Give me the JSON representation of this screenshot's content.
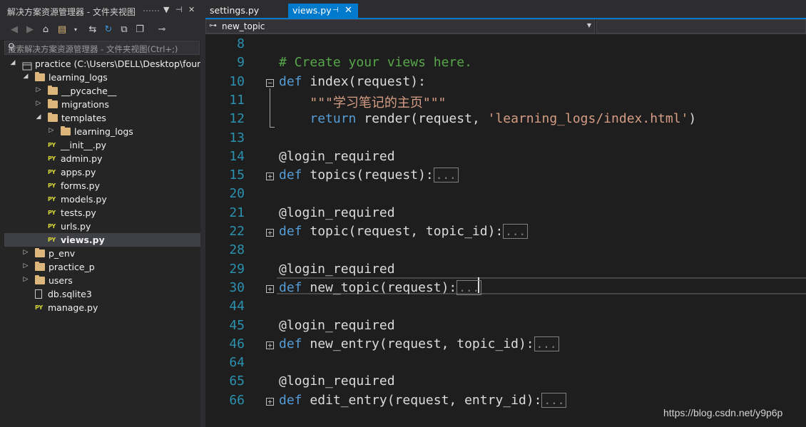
{
  "solution_explorer": {
    "title": "解决方案资源管理器 - 文件夹视图",
    "search_placeholder": "搜索解决方案资源管理器 - 文件夹视图(Ctrl+;)",
    "tree": [
      {
        "label": "practice (C:\\Users\\DELL\\Desktop\\four\\l",
        "icon": "solution-icon",
        "expanded": true
      },
      {
        "label": "learning_logs",
        "icon": "folder-icon",
        "expanded": true
      },
      {
        "label": "__pycache__",
        "icon": "folder-icon",
        "expanded": false
      },
      {
        "label": "migrations",
        "icon": "folder-icon",
        "expanded": false
      },
      {
        "label": "templates",
        "icon": "folder-icon",
        "expanded": true
      },
      {
        "label": "learning_logs",
        "icon": "folder-icon",
        "expanded": false
      },
      {
        "label": "__init__.py",
        "icon": "python-file-icon"
      },
      {
        "label": "admin.py",
        "icon": "python-file-icon"
      },
      {
        "label": "apps.py",
        "icon": "python-file-icon"
      },
      {
        "label": "forms.py",
        "icon": "python-file-icon"
      },
      {
        "label": "models.py",
        "icon": "python-file-icon"
      },
      {
        "label": "tests.py",
        "icon": "python-file-icon"
      },
      {
        "label": "urls.py",
        "icon": "python-file-icon"
      },
      {
        "label": "views.py",
        "icon": "python-file-icon",
        "selected": true
      },
      {
        "label": "p_env",
        "icon": "folder-icon",
        "expanded": false
      },
      {
        "label": "practice_p",
        "icon": "folder-icon",
        "expanded": false
      },
      {
        "label": "users",
        "icon": "folder-icon",
        "expanded": false
      },
      {
        "label": "db.sqlite3",
        "icon": "file-icon"
      },
      {
        "label": "manage.py",
        "icon": "python-file-icon"
      }
    ]
  },
  "editor": {
    "tabs": [
      {
        "label": "settings.py",
        "active": false
      },
      {
        "label": "views.py",
        "active": true
      }
    ],
    "navigation": {
      "member": "new_topic"
    },
    "lines": [
      {
        "num": "8",
        "code": ""
      },
      {
        "num": "9",
        "code": "# Create your views here."
      },
      {
        "num": "10",
        "code": "def index(request):"
      },
      {
        "num": "11",
        "code": "    \"\"\"学习笔记的主页\"\"\""
      },
      {
        "num": "12",
        "code": "    return render(request, 'learning_logs/index.html')"
      },
      {
        "num": "13",
        "code": ""
      },
      {
        "num": "14",
        "code": "@login_required"
      },
      {
        "num": "15",
        "code": "def topics(request):"
      },
      {
        "num": "20",
        "code": ""
      },
      {
        "num": "21",
        "code": "@login_required"
      },
      {
        "num": "22",
        "code": "def topic(request, topic_id):"
      },
      {
        "num": "28",
        "code": ""
      },
      {
        "num": "29",
        "code": "@login_required"
      },
      {
        "num": "30",
        "code": "def new_topic(request):"
      },
      {
        "num": "44",
        "code": ""
      },
      {
        "num": "45",
        "code": "@login_required"
      },
      {
        "num": "46",
        "code": "def new_entry(request, topic_id):"
      },
      {
        "num": "64",
        "code": ""
      },
      {
        "num": "65",
        "code": "@login_required"
      },
      {
        "num": "66",
        "code": "def edit_entry(request, entry_id):"
      }
    ],
    "collapsed_marker": "..."
  },
  "watermark": "https://blog.csdn.net/y9p6p"
}
